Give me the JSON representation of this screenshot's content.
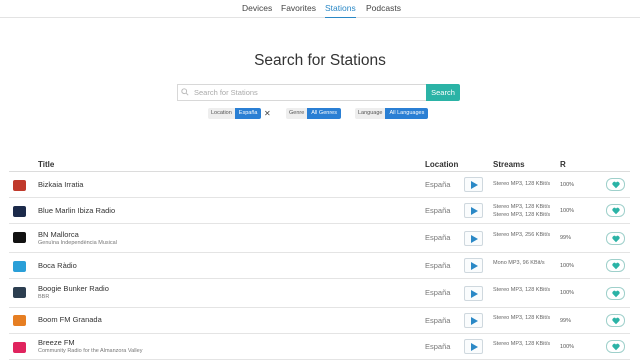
{
  "nav": {
    "tabs": [
      {
        "label": "Devices"
      },
      {
        "label": "Favorites"
      },
      {
        "label": "Stations"
      },
      {
        "label": "Podcasts"
      }
    ],
    "active": "Stations"
  },
  "page_title": "Search for Stations",
  "search": {
    "placeholder": "Search for Stations",
    "button_label": "Search"
  },
  "filters": {
    "location": {
      "key": "Location",
      "value": "España"
    },
    "genre": {
      "key": "Genre",
      "value": "All Genres"
    },
    "language": {
      "key": "Language",
      "value": "All Languages"
    }
  },
  "table": {
    "headers": {
      "title": "Title",
      "location": "Location",
      "streams": "Streams",
      "reliability": "R"
    },
    "rows": [
      {
        "name": "Bizkaia Irratia",
        "subtitle": "",
        "location": "España",
        "streams": [
          "Stereo MP3, 128 KBit/s"
        ],
        "reliability": "100%",
        "logo_color": "#c0392b"
      },
      {
        "name": "Blue Marlin Ibiza Radio",
        "subtitle": "",
        "location": "España",
        "streams": [
          "Stereo MP3, 128 KBit/s",
          "Stereo MP3, 128 KBit/s"
        ],
        "reliability": "100%",
        "logo_color": "#1b2a4a"
      },
      {
        "name": "BN Mallorca",
        "subtitle": "Genuïna Independència Musical",
        "location": "España",
        "streams": [
          "Stereo MP3, 256 KBit/s"
        ],
        "reliability": "99%",
        "logo_color": "#111111"
      },
      {
        "name": "Boca Ràdio",
        "subtitle": "",
        "location": "España",
        "streams": [
          "Mono MP3, 96 KBit/s"
        ],
        "reliability": "100%",
        "logo_color": "#2a9fd8"
      },
      {
        "name": "Boogie Bunker Radio",
        "subtitle": "BBR",
        "location": "España",
        "streams": [
          "Stereo MP3, 128 KBit/s"
        ],
        "reliability": "100%",
        "logo_color": "#2c3e50"
      },
      {
        "name": "Boom FM Granada",
        "subtitle": "",
        "location": "España",
        "streams": [
          "Stereo MP3, 128 KBit/s"
        ],
        "reliability": "99%",
        "logo_color": "#e67e22"
      },
      {
        "name": "Breeze FM",
        "subtitle": "Community Radio for the Almanzora Valley",
        "location": "España",
        "streams": [
          "Stereo MP3, 128 KBit/s"
        ],
        "reliability": "100%",
        "logo_color": "#e0245e"
      }
    ]
  },
  "icons": {
    "search": "search-icon",
    "remove": "close-icon",
    "play": "play-icon",
    "favorite": "heart-icon"
  },
  "colors": {
    "accent": "#2bb3a6",
    "link": "#2a88c6",
    "chip": "#2a7fd4"
  }
}
